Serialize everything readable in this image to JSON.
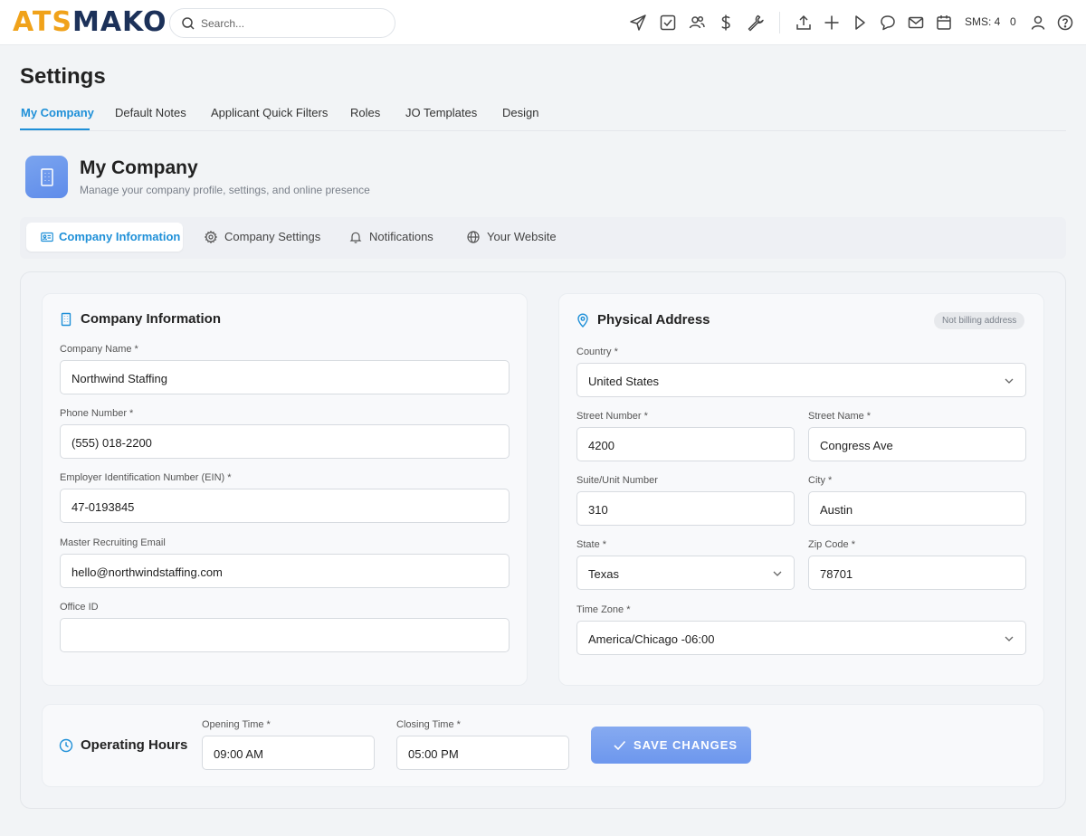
{
  "app": {
    "logo_part1": "ATS",
    "logo_part2": "MAKO"
  },
  "search": {
    "placeholder": "Search..."
  },
  "topbar": {
    "sms_label": "SMS: 4",
    "count": "0"
  },
  "page": {
    "title": "Settings"
  },
  "tabs": [
    "My Company",
    "Default Notes",
    "Applicant Quick Filters",
    "Roles",
    "JO Templates",
    "Design"
  ],
  "section": {
    "title": "My Company",
    "subtitle": "Manage your company profile, settings, and online presence"
  },
  "subtabs": [
    "Company Information",
    "Company Settings",
    "Notifications",
    "Your Website"
  ],
  "company_info": {
    "title": "Company Information",
    "company_name_label": "Company Name *",
    "company_name": "Northwind Staffing",
    "phone_label": "Phone Number *",
    "phone": "(555) 018-2200",
    "ein_label": "Employer Identification Number (EIN) *",
    "ein": "47-0193845",
    "email_label": "Master Recruiting Email",
    "email": "hello@northwindstaffing.com",
    "office_label": "Office ID",
    "office_id": ""
  },
  "address": {
    "title": "Physical Address",
    "badge": "Not billing address",
    "country_label": "Country *",
    "country": "United States",
    "street_number_label": "Street Number *",
    "street_number": "4200",
    "street_name_label": "Street Name *",
    "street_name": "Congress Ave",
    "suite_label": "Suite/Unit Number",
    "suite": "310",
    "city_label": "City *",
    "city": "Austin",
    "state_label": "State *",
    "state": "Texas",
    "zip_label": "Zip Code *",
    "zip": "78701",
    "timezone_label": "Time Zone *",
    "timezone": "America/Chicago -06:00"
  },
  "hours": {
    "title": "Operating Hours",
    "opening_label": "Opening Time *",
    "opening": "09:00 AM",
    "closing_label": "Closing Time *",
    "closing": "05:00 PM",
    "save_label": "SAVE CHANGES"
  },
  "colors": {
    "accent": "#1f90d8",
    "button": "#7aa0ef",
    "logo_orange": "#f0a21a",
    "logo_navy": "#1c3159"
  }
}
